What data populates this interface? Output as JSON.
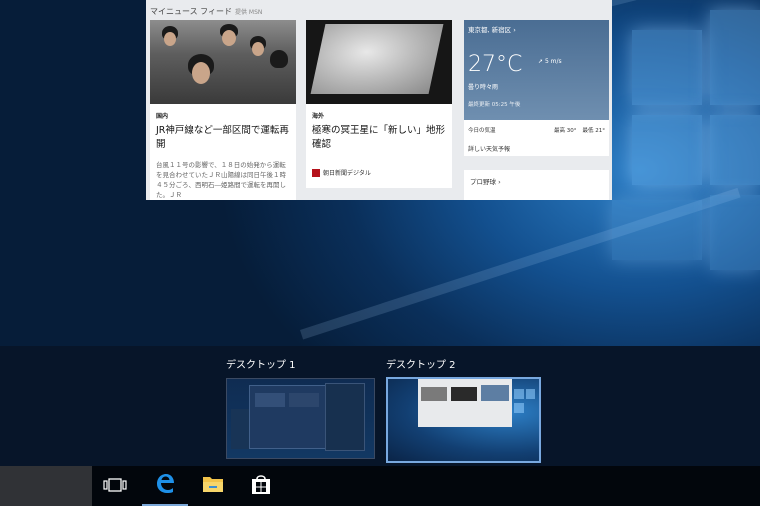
{
  "news": {
    "header": "マイニュース フィード",
    "header_source": "提供 MSN",
    "article1": {
      "category": "国内",
      "headline": "JR神戸線など一部区間で運転再開",
      "body": "台風１１号の影響で、１８日の始発から運転を見合わせていたＪＲ山陽線は同日午後１時４５分ごろ、西明石―姫路間で運転を再開した。ＪＲ"
    },
    "article2": {
      "category": "海外",
      "headline": "極寒の冥王星に「新しい」地形確認",
      "source": "朝日新聞デジタル"
    },
    "weather": {
      "location": "東京都, 新宿区",
      "temperature": "27°C",
      "wind": "5 m/s",
      "description": "曇り時々雨",
      "updated": "最終更新 05:25 午後",
      "today_label": "今日の気温",
      "high": "最高 30°",
      "low": "最低 21°",
      "more_link": "詳しい天気予報"
    },
    "card4_label": "プロ野球"
  },
  "taskview": {
    "desktop1_label": "デスクトップ 1",
    "desktop2_label": "デスクトップ 2"
  },
  "taskbar": {
    "icons": [
      "task-view-icon",
      "edge-icon",
      "file-explorer-icon",
      "store-icon"
    ]
  }
}
